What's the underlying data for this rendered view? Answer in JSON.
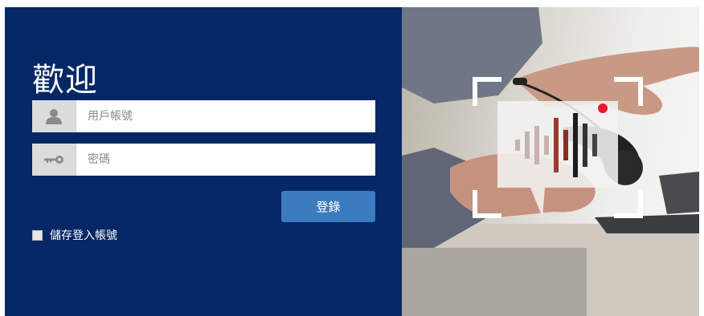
{
  "login": {
    "title": "歡迎",
    "username": {
      "placeholder": "用戶帳號",
      "value": ""
    },
    "password": {
      "placeholder": "密碼",
      "value": ""
    },
    "login_button": "登錄",
    "remember_label": "儲存登入帳號"
  },
  "icons": {
    "username_icon": "user-icon",
    "password_icon": "key-icon",
    "hero_icon": "voice-message-icon"
  },
  "colors": {
    "panel_background": "#052766",
    "button": "#3b7bbf",
    "recording_dot": "#e8192c"
  }
}
